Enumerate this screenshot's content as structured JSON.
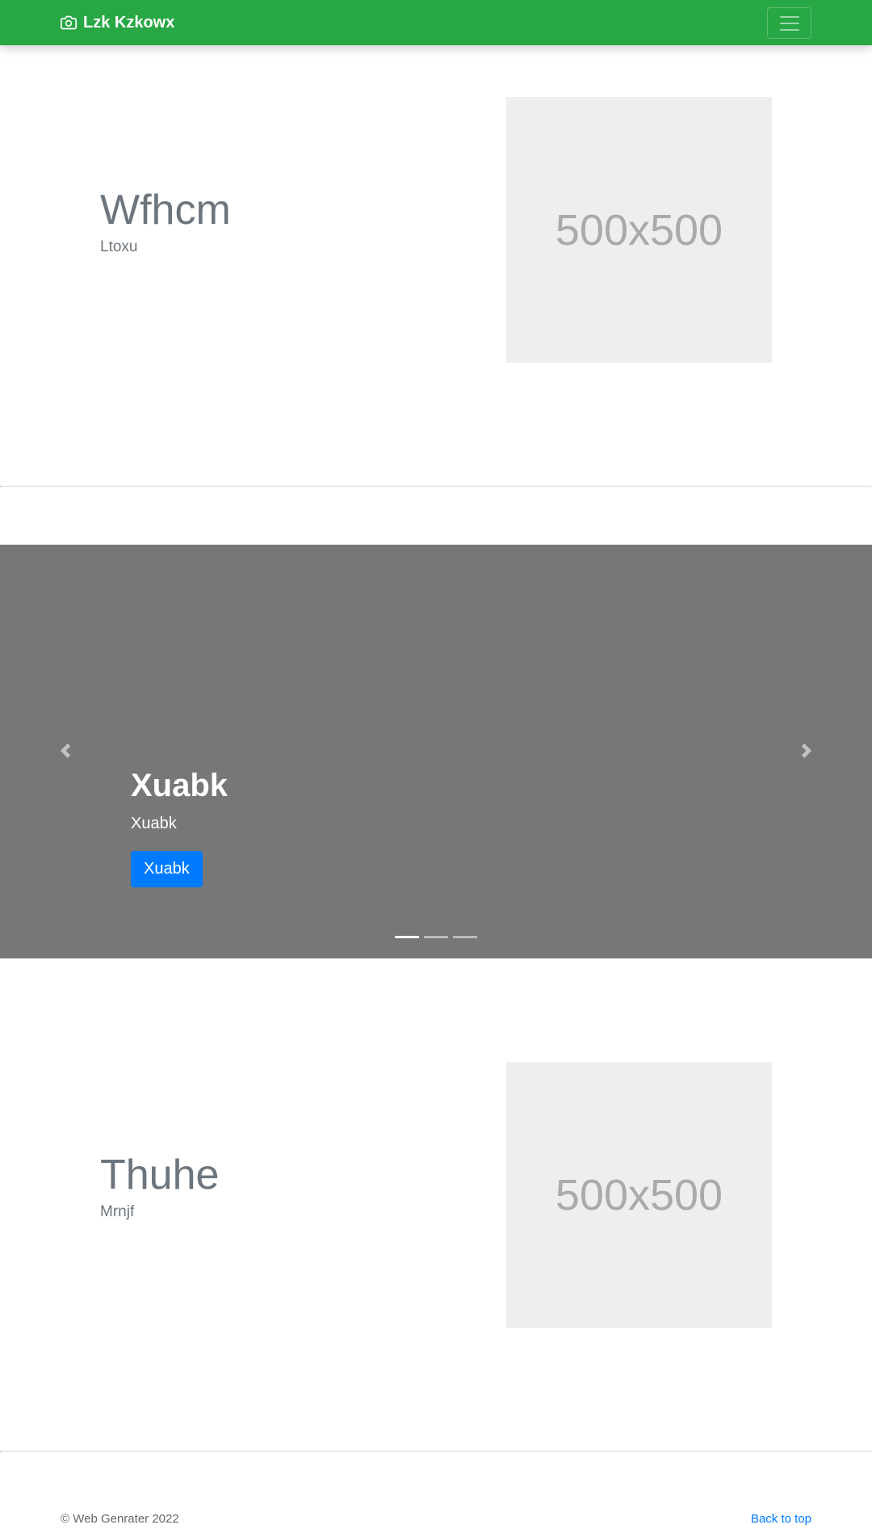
{
  "navbar": {
    "brand_icon": "camera-icon",
    "brand": "Lzk Kzkowx",
    "menu_icon": "hamburger-menu-icon",
    "background_color": "#28a745"
  },
  "features": [
    {
      "heading": "Wfhcm",
      "subtext": "Ltoxu",
      "image_label": "500x500"
    },
    {
      "heading": "Thuhe",
      "subtext": "Mrnjf",
      "image_label": "500x500"
    }
  ],
  "carousel": {
    "background_color": "#777777",
    "prev_icon": "chevron-left-icon",
    "next_icon": "chevron-right-icon",
    "caption": {
      "title": "Xuabk",
      "text": "Xuabk",
      "button_label": "Xuabk",
      "button_color": "#007bff"
    },
    "slide_count": 3,
    "active_slide": 1
  },
  "footer": {
    "copyright": "© Web Genrater 2022",
    "back_to_top": "Back to top",
    "link_color": "#007bff"
  }
}
